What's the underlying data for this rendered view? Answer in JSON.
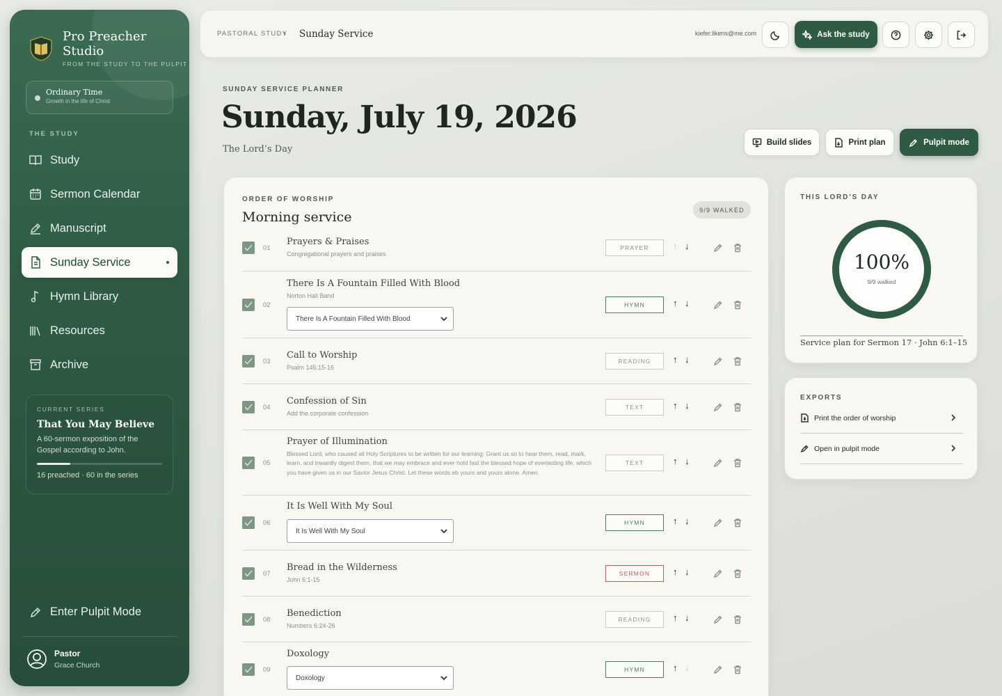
{
  "brand": {
    "name_line1": "Pro Preacher",
    "name_line2": "Studio",
    "tagline": "FROM THE STUDY TO THE PULPIT"
  },
  "season": {
    "title": "Ordinary Time",
    "subtitle": "Growth in the life of Christ"
  },
  "sidebar": {
    "section_label": "THE STUDY",
    "items": [
      {
        "label": "Study",
        "icon": "book-open-icon"
      },
      {
        "label": "Sermon Calendar",
        "icon": "calendar-icon"
      },
      {
        "label": "Manuscript",
        "icon": "pen-icon"
      },
      {
        "label": "Sunday Service",
        "icon": "document-icon",
        "active": true
      },
      {
        "label": "Hymn Library",
        "icon": "music-note-icon"
      },
      {
        "label": "Resources",
        "icon": "library-icon"
      },
      {
        "label": "Archive",
        "icon": "archive-box-icon"
      }
    ],
    "pulpit_mode_label": "Enter Pulpit Mode"
  },
  "series": {
    "label": "CURRENT SERIES",
    "title": "That You May Believe",
    "description": "A 60-sermon exposition of the Gospel according to John.",
    "progress": 0.267,
    "count_text": "16 preached · 60 in the series"
  },
  "user": {
    "name": "Pastor",
    "church": "Grace Church"
  },
  "topbar": {
    "crumb_root": "PASTORAL STUDY",
    "crumb_sep": "›",
    "crumb_current": "Sunday Service",
    "email": "kiefer.likens@me.com",
    "ask_label": "Ask the study"
  },
  "header": {
    "kicker": "SUNDAY SERVICE PLANNER",
    "title": "Sunday, July 19, 2026",
    "subtitle": "The Lord’s Day",
    "build_slides": "Build slides",
    "print_plan": "Print plan",
    "pulpit_mode": "Pulpit mode"
  },
  "order": {
    "kicker": "ORDER OF WORSHIP",
    "title": "Morning service",
    "badge": "9/9 WALKED",
    "items": [
      {
        "num": "01",
        "title": "Prayers & Praises",
        "subtitle": "Congregational prayers and praises",
        "tag": "PRAYER"
      },
      {
        "num": "02",
        "title": "There Is A Fountain Filled With Blood",
        "subtitle": "Norton Hall Band",
        "select": "There Is A Fountain Filled With Blood",
        "tag": "HYMN"
      },
      {
        "num": "03",
        "title": "Call to Worship",
        "subtitle": "Psalm 145:15-16",
        "tag": "READING"
      },
      {
        "num": "04",
        "title": "Confession of Sin",
        "subtitle": "Add the corporate confession",
        "tag": "TEXT"
      },
      {
        "num": "05",
        "title": "Prayer of Illumination",
        "subtitle": "Blessed Lord, who caused all Holy Scriptures to be written for our learning: Grant us so to hear them, read, mark, learn, and inwardly digest them, that we may embrace and ever hold fast the blessed hope of everlasting life, which you have given us in our Savior Jesus Christ. Let these words eb yours and yours alone. Amen.",
        "tag": "TEXT"
      },
      {
        "num": "06",
        "title": "It Is Well With My Soul",
        "select": "It Is Well With My Soul",
        "tag": "HYMN"
      },
      {
        "num": "07",
        "title": "Bread in the Wilderness",
        "subtitle": "John 6:1-15",
        "tag": "SERMON"
      },
      {
        "num": "08",
        "title": "Benediction",
        "subtitle": "Numbers 6:24-26",
        "tag": "READING"
      },
      {
        "num": "09",
        "title": "Doxology",
        "select": "Doxology",
        "tag": "HYMN"
      }
    ]
  },
  "lords_day": {
    "kicker": "THIS LORD’S DAY",
    "percent": "100%",
    "walked": "9/9 walked",
    "footer": "Service plan for Sermon 17 · John 6:1–15"
  },
  "exports": {
    "kicker": "EXPORTS",
    "items": [
      {
        "label": "Print the order of worship",
        "icon": "print-document-icon"
      },
      {
        "label": "Open in pulpit mode",
        "icon": "pen-icon"
      }
    ]
  },
  "colors": {
    "brand_green": "#2f5b44",
    "hymn": "#4f7a62",
    "sermon": "#b15d5d",
    "gold": "#c8a43c"
  }
}
